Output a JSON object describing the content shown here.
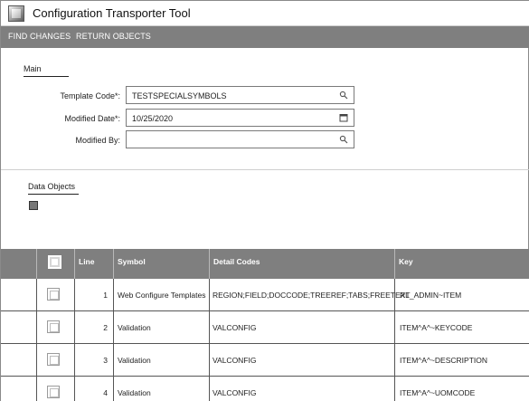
{
  "window": {
    "title": "Configuration Transporter Tool"
  },
  "menu": {
    "find_changes": "FIND CHANGES",
    "return_objects": "RETURN OBJECTS"
  },
  "main": {
    "title": "Main",
    "fields": {
      "template_code": {
        "label": "Template Code*:",
        "value": "TESTSPECIALSYMBOLS"
      },
      "modified_date": {
        "label": "Modified Date*:",
        "value": "10/25/2020"
      },
      "modified_by": {
        "label": "Modified By:",
        "value": ""
      }
    }
  },
  "data_objects": {
    "title": "Data Objects",
    "table": {
      "headers": [
        "Line",
        "Symbol",
        "Detail Codes",
        "Key"
      ],
      "rows": [
        {
          "line": "1",
          "symbol": "Web Configure Templates",
          "detail_codes": "REGION;FIELD;DOCCODE;TREEREF;TABS;FREETEXT",
          "key": "RL_ADMIN~ITEM"
        },
        {
          "line": "2",
          "symbol": "Validation",
          "detail_codes": "VALCONFIG",
          "key": "ITEM^A^~KEYCODE"
        },
        {
          "line": "3",
          "symbol": "Validation",
          "detail_codes": "VALCONFIG",
          "key": "ITEM^A^~DESCRIPTION"
        },
        {
          "line": "4",
          "symbol": "Validation",
          "detail_codes": "VALCONFIG",
          "key": "ITEM^A^~UOMCODE"
        }
      ]
    }
  }
}
